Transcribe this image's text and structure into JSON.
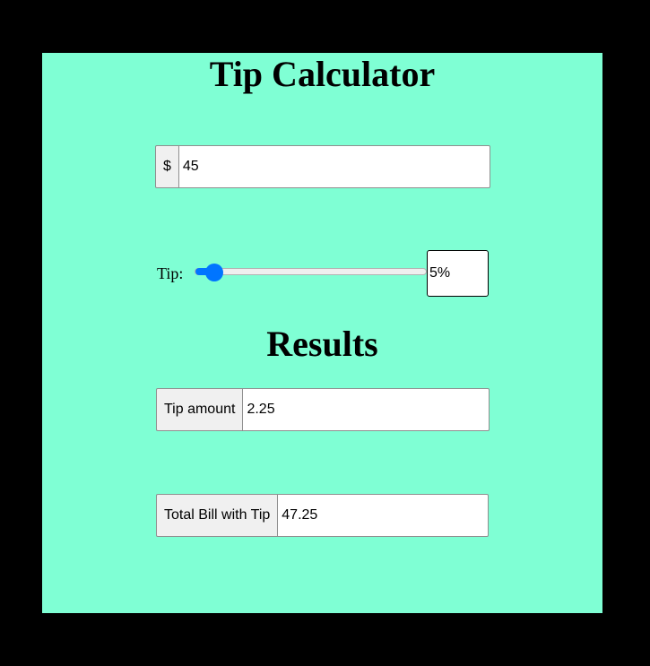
{
  "app": {
    "title": "Tip Calculator"
  },
  "bill": {
    "currency_symbol": "$",
    "value": "45"
  },
  "tip": {
    "label": "Tip:",
    "percent_fraction": 0.05,
    "percent_text": "5%"
  },
  "results": {
    "heading": "Results",
    "tip_amount_label": "Tip amount",
    "tip_amount_value": "2.25",
    "total_label": "Total Bill with Tip",
    "total_value": "47.25"
  },
  "colors": {
    "page_background": "#000000",
    "panel_background": "#7fffd4",
    "slider_accent": "#0075ff"
  }
}
